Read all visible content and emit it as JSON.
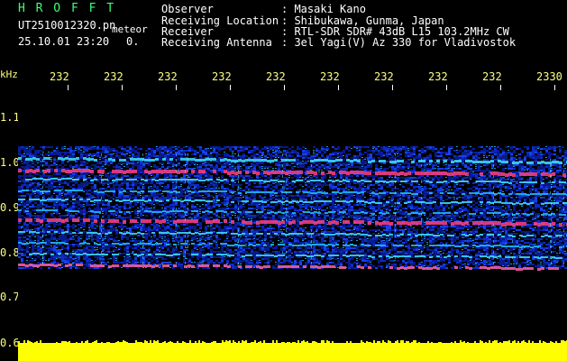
{
  "header": {
    "brand": "H R O F F T",
    "filename": "UT2510012320.pn",
    "meteor_label": "meteor",
    "datetime": "25.10.01 23:20",
    "count": "0.",
    "observer_label": "Observer",
    "observer_value": ": Masaki Kano",
    "location_label": "Receiving Location",
    "location_value": ": Shibukawa, Gunma, Japan",
    "receiver_label": "Receiver",
    "receiver_value": ": RTL-SDR SDR# 43dB L15 103.2MHz CW",
    "antenna_label": "Receiving Antenna",
    "antenna_value": ": 3el Yagi(V) Az 330 for Vladivostok"
  },
  "axis": {
    "unit": "kHz",
    "y_ticks": [
      "1.1",
      "1.0",
      "0.9",
      "0.8",
      "0.7",
      "0.6"
    ],
    "x_ticks": [
      "232",
      "232",
      "232",
      "232",
      "232",
      "232",
      "232",
      "232",
      "232",
      "2330"
    ]
  },
  "colors": {
    "label": "#ffff80",
    "brand": "#3bff7a",
    "background": "#000000",
    "signal": "#ffff00"
  }
}
